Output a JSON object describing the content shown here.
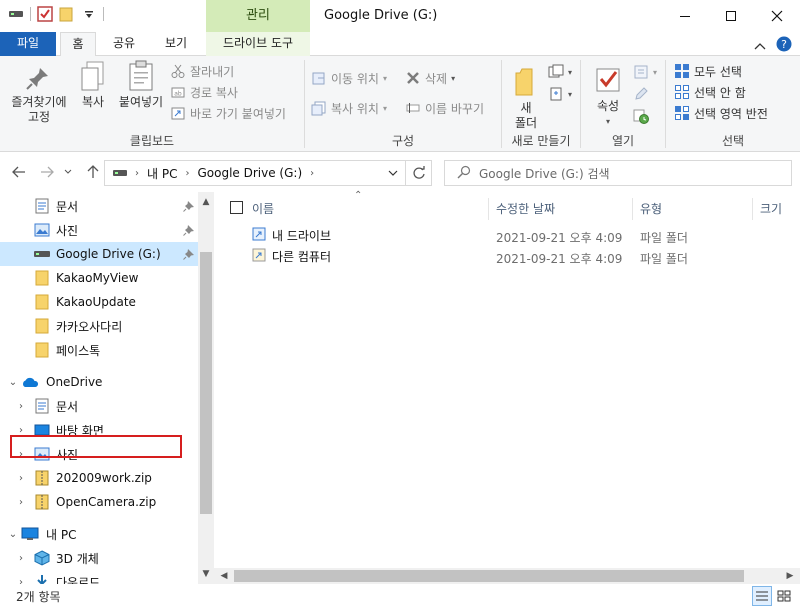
{
  "window": {
    "title": "Google Drive (G:)",
    "context_tab": "관리",
    "minimize_icon": "minimize-icon",
    "maximize_icon": "maximize-icon",
    "close_icon": "close-icon"
  },
  "ribbon_tabs": {
    "file": "파일",
    "home": "홈",
    "share": "공유",
    "view": "보기",
    "drive_tools": "드라이브 도구"
  },
  "ribbon": {
    "clipboard": {
      "label": "클립보드",
      "pin_quick": "즐겨찾기에\n고정",
      "copy": "복사",
      "paste": "붙여넣기",
      "cut": "잘라내기",
      "copy_path": "경로 복사",
      "paste_shortcut": "바로 가기 붙여넣기"
    },
    "organize": {
      "label": "구성",
      "move_to": "이동 위치",
      "copy_to": "복사 위치",
      "delete": "삭제",
      "rename": "이름 바꾸기"
    },
    "new": {
      "label": "새로 만들기",
      "new_folder": "새\n폴더"
    },
    "open": {
      "label": "열기",
      "properties": "속성"
    },
    "select": {
      "label": "선택",
      "select_all": "모두 선택",
      "select_none": "선택 안 함",
      "invert": "선택 영역 반전"
    }
  },
  "address": {
    "crumbs": [
      "내 PC",
      "Google Drive (G:)"
    ],
    "search_placeholder": "Google Drive (G:) 검색"
  },
  "nav": {
    "quick_access": [
      {
        "label": "문서",
        "icon": "document-folder-icon",
        "pinned": true
      },
      {
        "label": "사진",
        "icon": "pictures-folder-icon",
        "pinned": true
      },
      {
        "label": "Google Drive (G:)",
        "icon": "drive-icon",
        "pinned": true
      },
      {
        "label": "KakaoMyView",
        "icon": "folder-icon"
      },
      {
        "label": "KakaoUpdate",
        "icon": "folder-icon"
      },
      {
        "label": "카카오사다리",
        "icon": "folder-icon"
      },
      {
        "label": "페이스톡",
        "icon": "folder-icon"
      }
    ],
    "onedrive": {
      "label": "OneDrive",
      "items": [
        {
          "label": "문서",
          "icon": "document-folder-icon"
        },
        {
          "label": "바탕 화면",
          "icon": "desktop-folder-icon"
        },
        {
          "label": "사진",
          "icon": "pictures-folder-icon"
        },
        {
          "label": "202009work.zip",
          "icon": "zip-icon"
        },
        {
          "label": "OpenCamera.zip",
          "icon": "zip-icon"
        }
      ]
    },
    "this_pc": {
      "label": "내 PC",
      "items": [
        {
          "label": "3D 개체",
          "icon": "3d-objects-icon"
        },
        {
          "label": "다운로드",
          "icon": "downloads-icon"
        }
      ]
    }
  },
  "columns": {
    "name": "이름",
    "modified": "수정한 날짜",
    "type": "유형",
    "size": "크기"
  },
  "files": [
    {
      "name": "내 드라이브",
      "modified": "2021-09-21 오후 4:09",
      "type": "파일 폴더",
      "icon": "shortcut-folder-icon"
    },
    {
      "name": "다른 컴퓨터",
      "modified": "2021-09-21 오후 4:09",
      "type": "파일 폴더",
      "icon": "shortcut-folder-icon"
    }
  ],
  "status": {
    "count": "2개 항목"
  },
  "colors": {
    "accent": "#1c63b8",
    "context_tab": "#d4ebb8",
    "selection": "#cce8ff",
    "highlight_box": "#d61e1e",
    "folder": "#f7d36b"
  }
}
